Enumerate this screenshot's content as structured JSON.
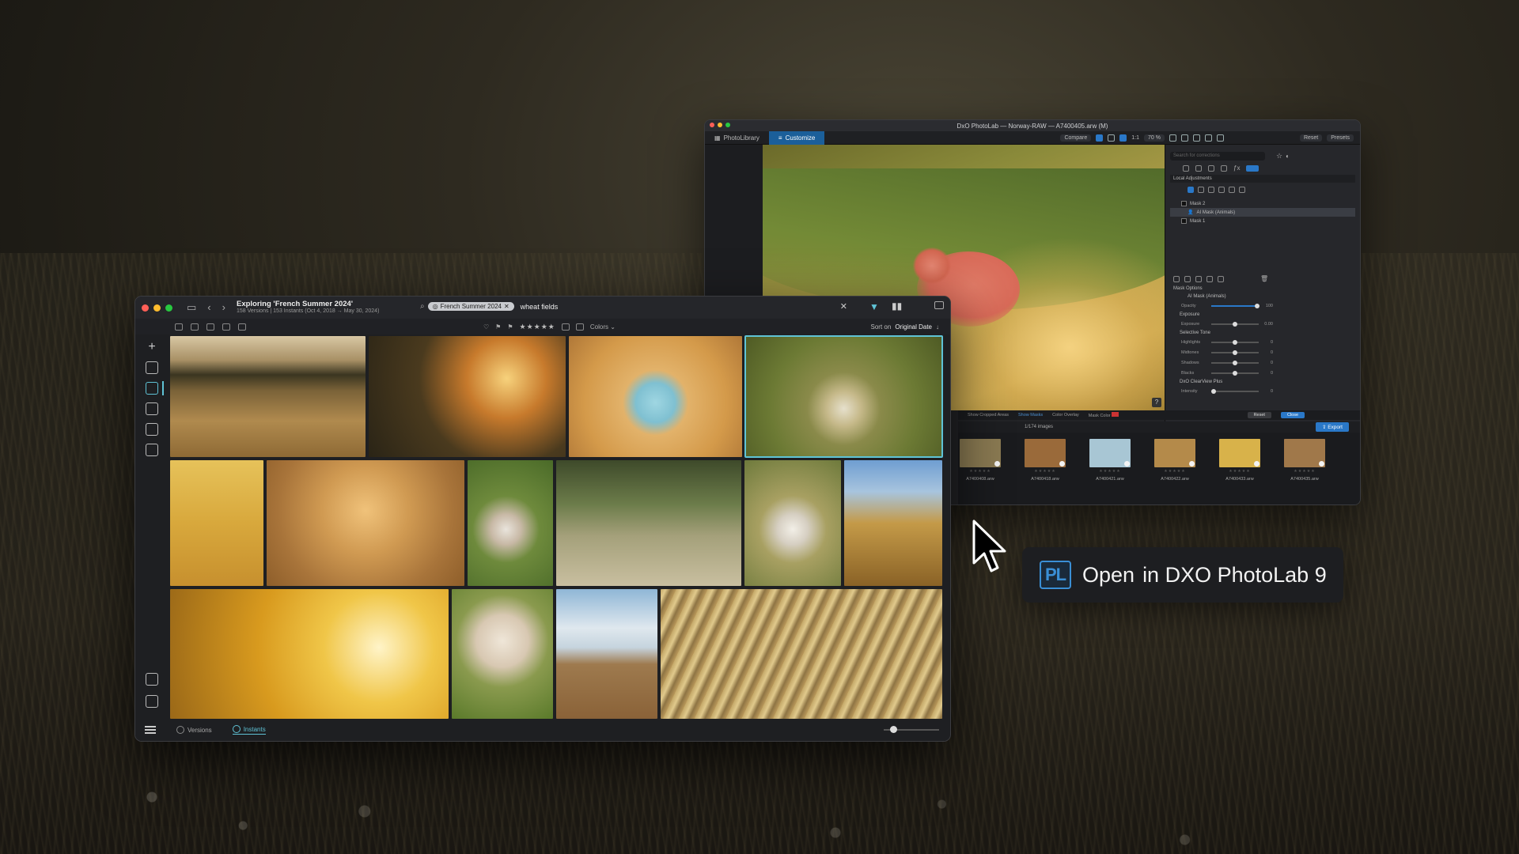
{
  "photolab": {
    "title": "DxO PhotoLab — Norway-RAW — A7400405.arw (M)",
    "tabs": [
      "PhotoLibrary",
      "Customize"
    ],
    "compare": "Compare",
    "zoom": "70 %",
    "ratio": "1:1",
    "reset_top": "Reset",
    "presets": "Presets",
    "search_placeholder": "Search for corrections",
    "local_adjustments": "Local Adjustments",
    "masks": [
      "Mask 2",
      "AI Mask (Animals)",
      "Mask 1"
    ],
    "mask_options": "Mask Options",
    "ai_mask_label": "AI Mask (Animals)",
    "opacity": {
      "label": "Opacity",
      "value": "100"
    },
    "exposure_section": "Exposure",
    "exposure": {
      "label": "Exposure",
      "value": "0.00"
    },
    "selective_tone": "Selective Tone",
    "tones": [
      {
        "label": "Highlights",
        "value": "0"
      },
      {
        "label": "Midtones",
        "value": "0"
      },
      {
        "label": "Shadows",
        "value": "0"
      },
      {
        "label": "Blacks",
        "value": "0"
      }
    ],
    "clearview": "DxO ClearView Plus",
    "intensity": {
      "label": "Intensity",
      "value": "0"
    },
    "bottom_bar": {
      "show_cropped": "Show Cropped Areas",
      "show_masks": "Show Masks",
      "color_overlay": "Color Overlay",
      "mask_color": "Mask Color",
      "reset": "Reset",
      "close": "Close"
    },
    "image_count": "1/174 images",
    "export": "Export",
    "help": "?",
    "filmstrip": [
      {
        "name": "A7400408.arw",
        "color": "#8a7a52"
      },
      {
        "name": "A7400418.arw",
        "color": "#9a6a3a"
      },
      {
        "name": "A7400421.arw",
        "color": "#a8c6d4"
      },
      {
        "name": "A7400422.arw",
        "color": "#b48a4a"
      },
      {
        "name": "A7400433.arw",
        "color": "#d8b24a"
      },
      {
        "name": "A7400435.arw",
        "color": "#a0784a"
      }
    ]
  },
  "library": {
    "title": "Exploring 'French Summer 2024'",
    "subtitle": "158 Versions | 153 Instants (Oct 4, 2018 → May 30, 2024)",
    "chip": "French Summer 2024",
    "search_value": "wheat fields",
    "colors": "Colors",
    "stars": "★★★★★",
    "sort_label": "Sort on",
    "sort_value": "Original Date",
    "footer": {
      "versions": "Versions",
      "instants": "Instants"
    }
  },
  "badge": {
    "logo": "PL",
    "text": "Open",
    "app": "in DXO PhotoLab 9"
  },
  "colors": {
    "accent": "#5fc3d6",
    "blue": "#2a78c8"
  }
}
